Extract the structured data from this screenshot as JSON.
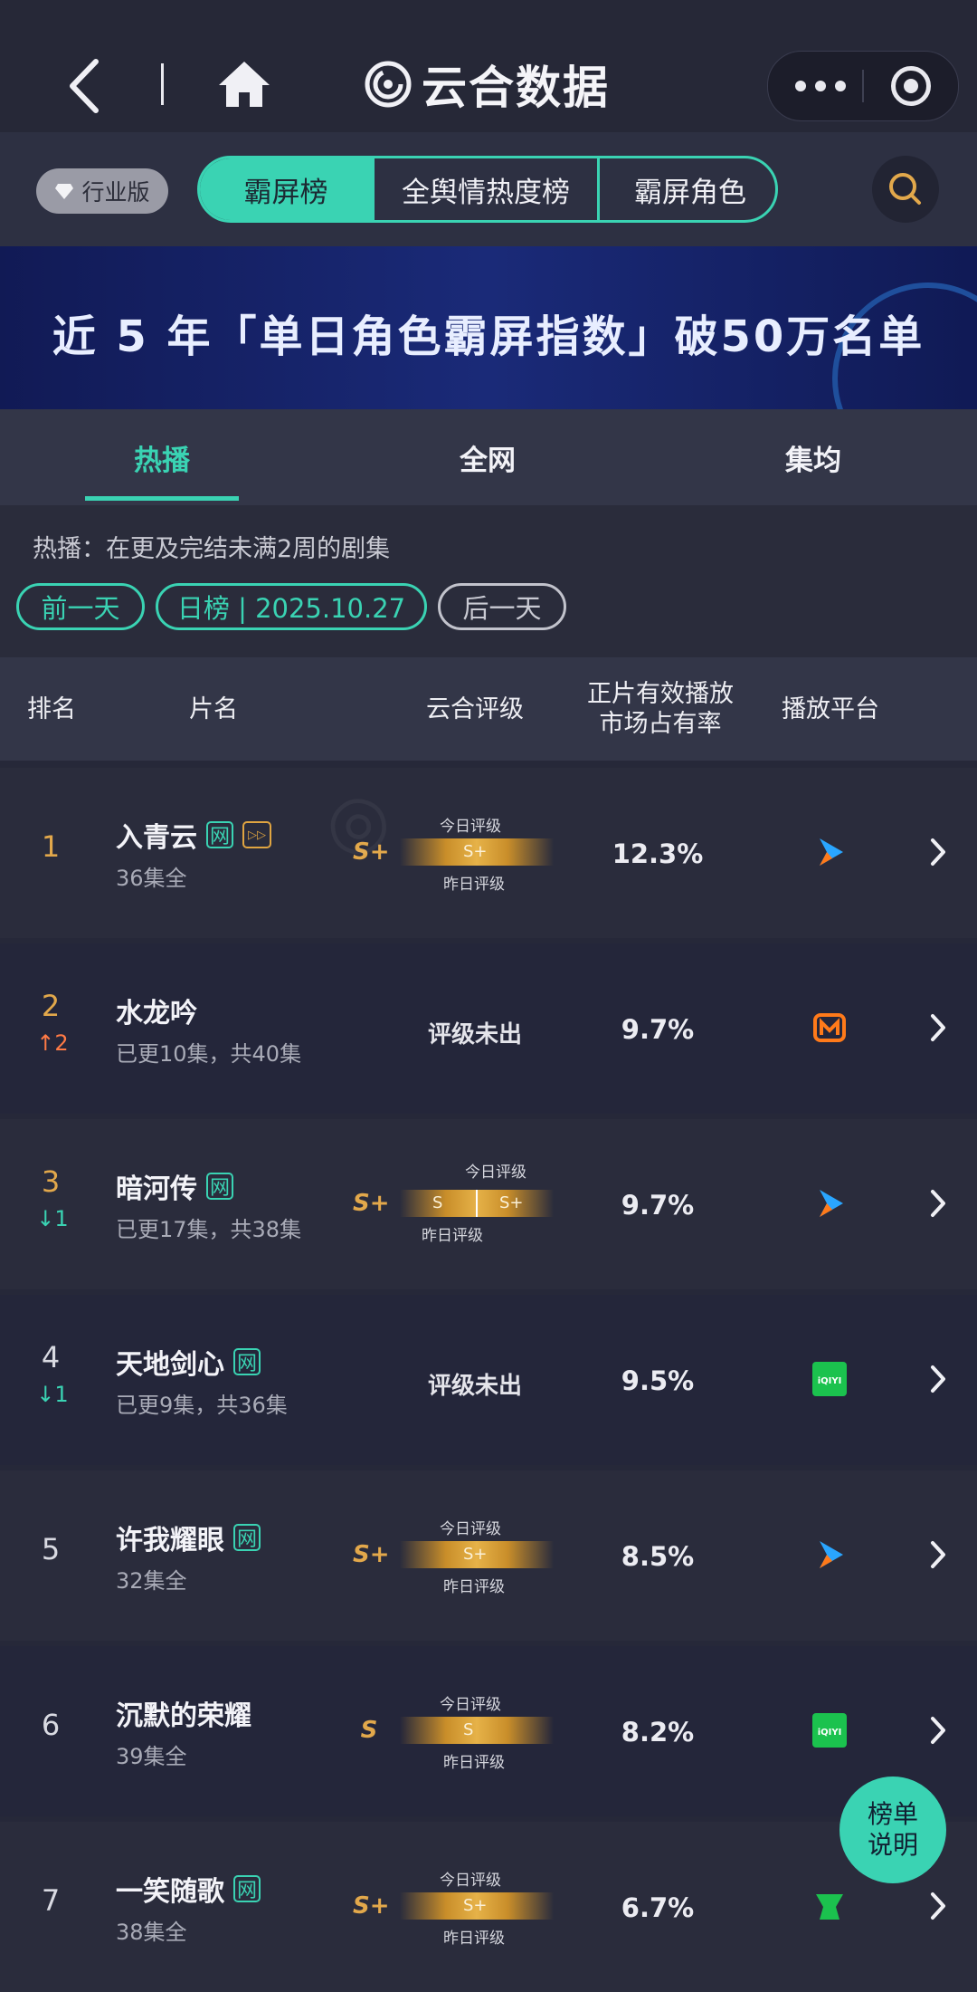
{
  "header": {
    "brand_name": "云合数据",
    "icons": [
      "back-icon",
      "home-icon",
      "more-icon",
      "target-icon"
    ]
  },
  "subbar": {
    "edition": "行业版",
    "segments": [
      "霸屏榜",
      "全舆情热度榜",
      "霸屏角色"
    ],
    "active_segment": "霸屏榜"
  },
  "banner": {
    "title": "近 5 年「单日角色霸屏指数」破50万名单"
  },
  "tabs": {
    "items": [
      "热播",
      "全网",
      "集均"
    ],
    "active": "热播"
  },
  "filter": {
    "hint": "热播：在更及完结未满2周的剧集",
    "prev_day": "前一天",
    "date_label": "日榜 | 2025.10.27",
    "next_day": "后一天"
  },
  "table": {
    "headers": {
      "rank": "排名",
      "title": "片名",
      "rating": "云合评级",
      "share_line1": "正片有效播放",
      "share_line2": "市场占有率",
      "platform": "播放平台"
    },
    "today_label": "今日评级",
    "yesterday_label": "昨日评级",
    "rows": [
      {
        "rank": "1",
        "change": "",
        "title": "入青云",
        "tags": [
          "网",
          "ff"
        ],
        "sub": "36集全",
        "grade": "S+",
        "today": "S+",
        "yesterday": "",
        "rating_text": "",
        "share": "12.3%",
        "platform": "tencent-video-icon"
      },
      {
        "rank": "2",
        "change": "↑2",
        "title": "水龙吟",
        "tags": [],
        "sub": "已更10集，共40集",
        "grade": "",
        "today": "",
        "yesterday": "",
        "rating_text": "评级未出",
        "share": "9.7%",
        "platform": "mango-tv-icon"
      },
      {
        "rank": "3",
        "change": "↓1",
        "title": "暗河传",
        "tags": [
          "网"
        ],
        "sub": "已更17集，共38集",
        "grade": "S+",
        "today": "S+",
        "yesterday": "S",
        "rating_text": "",
        "share": "9.7%",
        "platform": "tencent-video-icon"
      },
      {
        "rank": "4",
        "change": "↓1",
        "title": "天地剑心",
        "tags": [
          "网"
        ],
        "sub": "已更9集，共36集",
        "grade": "",
        "today": "",
        "yesterday": "",
        "rating_text": "评级未出",
        "share": "9.5%",
        "platform": "iqiyi-icon"
      },
      {
        "rank": "5",
        "change": "",
        "title": "许我耀眼",
        "tags": [
          "网"
        ],
        "sub": "32集全",
        "grade": "S+",
        "today": "S+",
        "yesterday": "",
        "rating_text": "",
        "share": "8.5%",
        "platform": "tencent-video-icon"
      },
      {
        "rank": "6",
        "change": "",
        "title": "沉默的荣耀",
        "tags": [],
        "sub": "39集全",
        "grade": "S",
        "today": "S",
        "yesterday": "",
        "rating_text": "",
        "share": "8.2%",
        "platform": "iqiyi-icon"
      },
      {
        "rank": "7",
        "change": "",
        "title": "一笑随歌",
        "tags": [
          "网"
        ],
        "sub": "38集全",
        "grade": "S+",
        "today": "S+",
        "yesterday": "",
        "rating_text": "",
        "share": "6.7%",
        "platform": "youku-icon"
      }
    ]
  },
  "fab": {
    "line1": "榜单",
    "line2": "说明"
  },
  "iqiyi_text": "iQIYI",
  "colors": {
    "accent": "#3ad3b3",
    "gold": "#e2a84b",
    "rank_top": "#e2a84b",
    "up": "#ff7a45",
    "down": "#3ad3b3"
  }
}
